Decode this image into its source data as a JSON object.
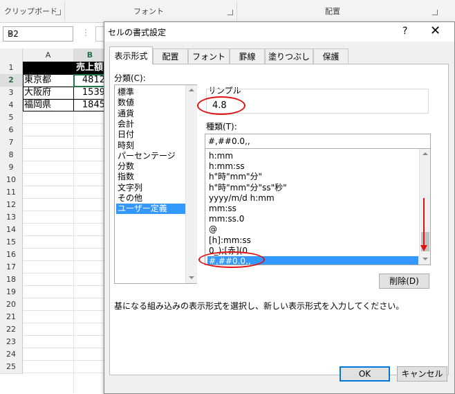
{
  "ribbon": {
    "groups": [
      "クリップボード",
      "フォント",
      "配置"
    ]
  },
  "formula_bar": {
    "name_box": "B2",
    "dots": "⋮"
  },
  "sheet": {
    "columns": [
      "A",
      "B"
    ],
    "rows": [
      "1",
      "2",
      "3",
      "4",
      "5",
      "6",
      "7",
      "8",
      "9",
      "10",
      "11",
      "12",
      "13",
      "14",
      "15",
      "16",
      "17",
      "18",
      "19",
      "20",
      "21",
      "22",
      "23",
      "24",
      "25"
    ],
    "header_cell": "売上額",
    "data": [
      {
        "city": "東京都",
        "value": "4812"
      },
      {
        "city": "大阪府",
        "value": "1539"
      },
      {
        "city": "福岡県",
        "value": "1845"
      }
    ]
  },
  "dialog": {
    "title": "セルの書式設定",
    "help": "?",
    "close": "✕",
    "tabs": [
      "表示形式",
      "配置",
      "フォント",
      "罫線",
      "塗りつぶし",
      "保護"
    ],
    "category_label": "分類(C):",
    "categories": [
      "標準",
      "数値",
      "通貨",
      "会計",
      "日付",
      "時刻",
      "パーセンテージ",
      "分数",
      "指数",
      "文字列",
      "その他",
      "ユーザー定義"
    ],
    "sample_label": "サンプル",
    "sample_value": "4.8",
    "type_label": "種類(T):",
    "type_value": "#,##0.0,,",
    "formats": [
      "h:mm",
      "h:mm:ss",
      "h\"時\"mm\"分\"",
      "h\"時\"mm\"分\"ss\"秒\"",
      "yyyy/m/d h:mm",
      "mm:ss",
      "mm:ss.0",
      "@",
      "[h]:mm:ss",
      "0_);[赤](0",
      "#,##0.0,,"
    ],
    "delete_button": "削除(D)",
    "description": "基になる組み込みの表示形式を選択し、新しい表示形式を入力してください。",
    "ok_button": "OK",
    "cancel_button": "キャンセル"
  },
  "colors": {
    "accent_green": "#217346",
    "selection_blue": "#3399ff",
    "annotation_red": "#e01010",
    "primary_border": "#0078d7"
  }
}
